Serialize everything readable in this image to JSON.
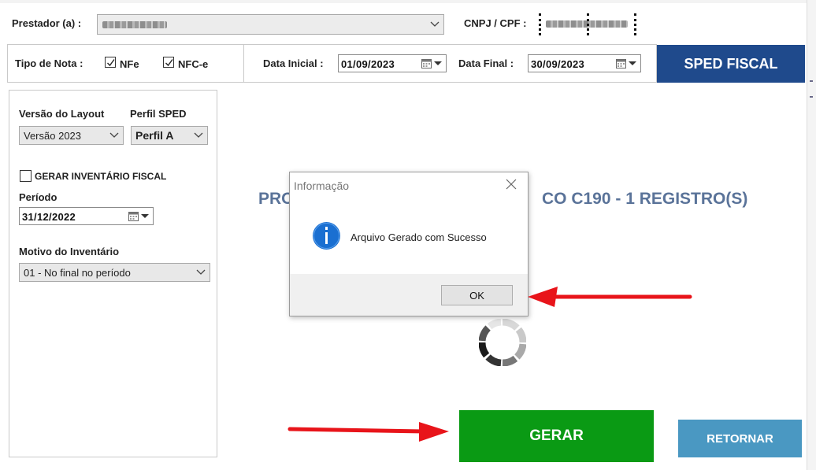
{
  "header": {
    "prestador_label": "Prestador (a) :",
    "cnpj_label": "CNPJ / CPF :"
  },
  "filters": {
    "tipo_nota_label": "Tipo de Nota :",
    "nfe_label": "NFe",
    "nfce_label": "NFC-e",
    "nfe_checked": true,
    "nfce_checked": true,
    "data_inicial_label": "Data Inicial :",
    "data_inicial_value": "01/09/2023",
    "data_final_label": "Data Final :",
    "data_final_value": "30/09/2023",
    "sped_button": "SPED FISCAL"
  },
  "left_panel": {
    "versao_label": "Versão do Layout",
    "versao_value": "Versão 2023",
    "perfil_label": "Perfil SPED",
    "perfil_value": "Perfil A",
    "gerar_inventario_label": "GERAR INVENTÁRIO FISCAL",
    "gerar_inventario_checked": false,
    "periodo_label": "Período",
    "periodo_value": "31/12/2022",
    "motivo_label": "Motivo do Inventário",
    "motivo_value": "01 - No final no período"
  },
  "main": {
    "processing_left": "PRO",
    "processing_right": "CO C190 - 1 REGISTRO(S)"
  },
  "dialog": {
    "title": "Informação",
    "message": "Arquivo Gerado com Sucesso",
    "ok_label": "OK"
  },
  "buttons": {
    "gerar": "GERAR",
    "retornar": "RETORNAR"
  },
  "colors": {
    "sped_blue": "#1f4a8c",
    "gerar_green": "#0a9a14",
    "retornar_blue": "#4a98c2",
    "annotation_red": "#e8141a",
    "info_icon_blue": "#1a6fd1"
  }
}
